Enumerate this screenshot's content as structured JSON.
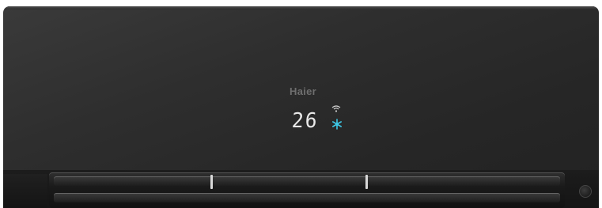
{
  "device": {
    "brand": "Haier",
    "display": {
      "temperature": "26",
      "status_icons": [
        "wifi-icon",
        "snowflake-cool-icon"
      ]
    }
  },
  "colors": {
    "body": "#2b2b2b",
    "logo": "#6f6f6f",
    "digits": "#e9e9e9",
    "cool_indicator": "#3ec8e6",
    "background": "#ffffff"
  }
}
